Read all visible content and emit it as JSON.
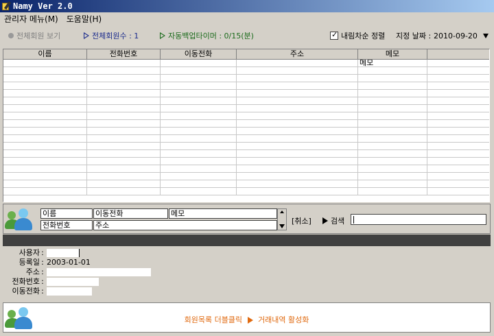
{
  "window": {
    "title": "Namy Ver 2.0"
  },
  "menu": {
    "items": [
      "관리자 메뉴(M)",
      "도움말(H)"
    ]
  },
  "toolbar": {
    "view_all": "전체회원 보기",
    "member_count": "전체회원수 : 1",
    "backup_timer": "자동백업타이머 : 0/15(분)",
    "sort_desc": "내림차순 정렬",
    "sort_checked": true,
    "date_label": "지정 날짜 :",
    "date_value": "2010-09-20"
  },
  "table": {
    "columns": [
      "이름",
      "전화번호",
      "이동전화",
      "주소",
      "메모",
      ""
    ],
    "rows": [
      [
        "",
        "",
        "",
        "",
        "메모",
        ""
      ]
    ],
    "empty_rows": 17
  },
  "editor": {
    "name_label": "이름",
    "mobile_label": "이동전화",
    "memo_label": "메모",
    "phone_label": "전화번호",
    "address_label": "주소",
    "cancel": "[취소]",
    "search": "검색",
    "search_value": ""
  },
  "info": {
    "user_label": "사용자",
    "reg_label": "등록일",
    "reg_value": "2003-01-01",
    "addr_label": "주소",
    "phone_label": "전화번호",
    "mobile_label": "이동전화"
  },
  "hint": {
    "part1": "회원목록 더블클릭",
    "part2": "거래내역 활성화"
  }
}
